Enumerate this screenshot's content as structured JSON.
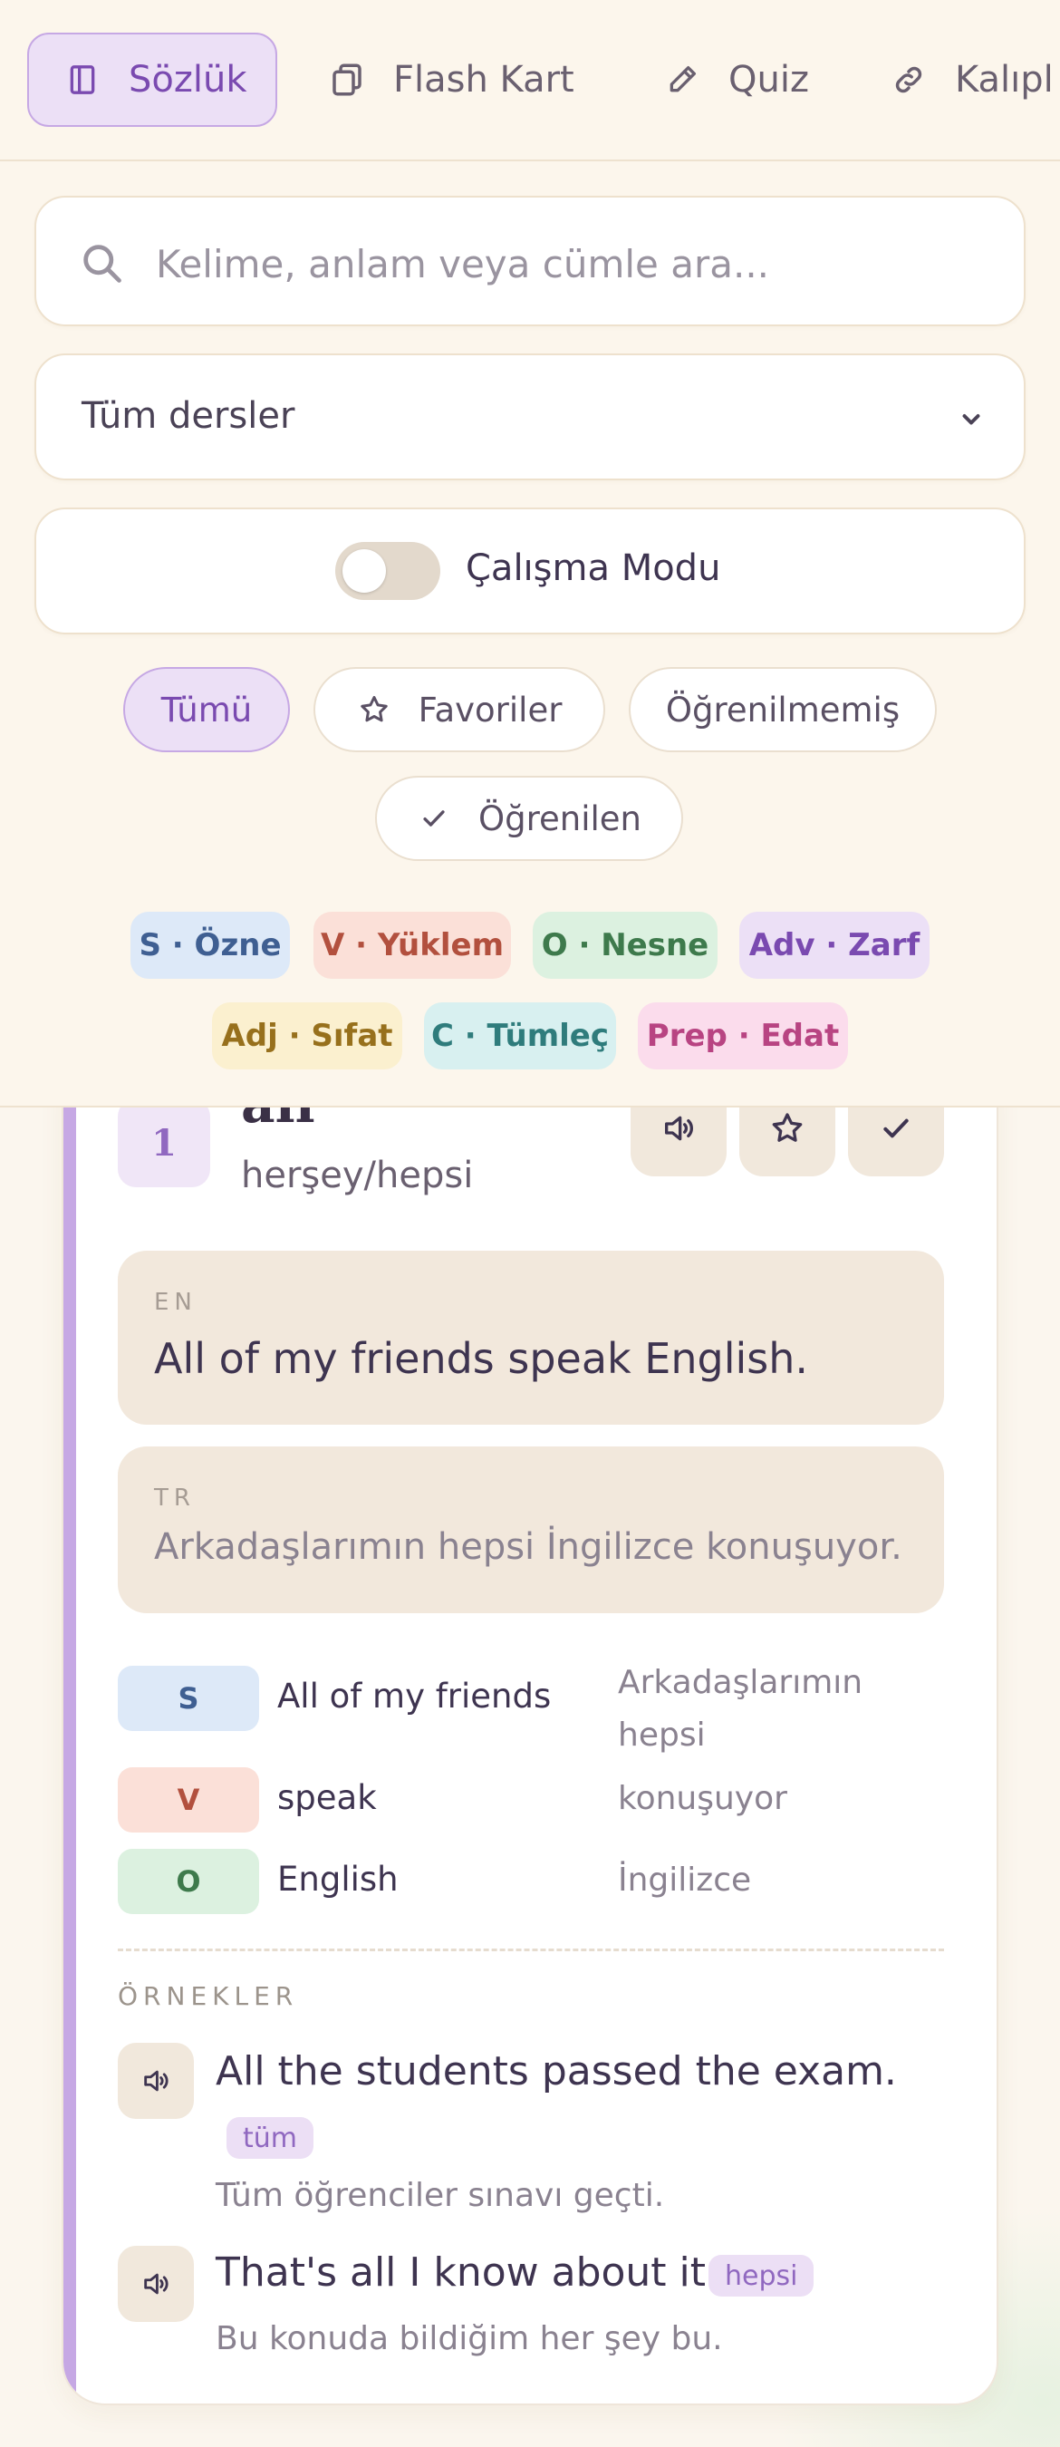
{
  "nav": {
    "items": [
      {
        "label": "Sözlük",
        "icon": "book-icon",
        "active": true
      },
      {
        "label": "Flash Kart",
        "icon": "cards-icon"
      },
      {
        "label": "Quiz",
        "icon": "pencil-icon"
      },
      {
        "label": "Kalıpl",
        "icon": "link-icon"
      }
    ]
  },
  "search": {
    "placeholder": "Kelime, anlam veya cümle ara...",
    "value": ""
  },
  "lesson_select": {
    "selected": "Tüm dersler"
  },
  "study_mode": {
    "label": "Çalışma Modu",
    "enabled": false
  },
  "filters": [
    {
      "label": "Tümü",
      "active": true
    },
    {
      "label": "Favoriler",
      "icon": "star-icon"
    },
    {
      "label": "Öğrenilmemiş"
    },
    {
      "label": "Öğrenilen",
      "icon": "check-icon"
    }
  ],
  "legend": [
    {
      "label": "S · Özne",
      "bg": "#dde9f8",
      "fg": "#3f5f92"
    },
    {
      "label": "V · Yüklem",
      "bg": "#fbe0d8",
      "fg": "#b2503e"
    },
    {
      "label": "O · Nesne",
      "bg": "#dcf1e0",
      "fg": "#3e7a4c"
    },
    {
      "label": "Adv · Zarf",
      "bg": "#ece0f6",
      "fg": "#7a4ab0"
    },
    {
      "label": "Adj · Sıfat",
      "bg": "#fbf0cf",
      "fg": "#97701c"
    },
    {
      "label": "C · Tümleç",
      "bg": "#d8f0f0",
      "fg": "#2f7c7c"
    },
    {
      "label": "Prep · Edat",
      "bg": "#fbdcec",
      "fg": "#b84482"
    }
  ],
  "card": {
    "number": "1",
    "word": "all",
    "meaning": "herşey/hepsi",
    "accent": "#c6a8e4",
    "en_label": "EN",
    "en_sentence": "All of my friends speak English.",
    "tr_label": "TR",
    "tr_sentence": "Arkadaşlarımın hepsi İngilizce konuşuyor.",
    "roles": [
      {
        "tag": "S",
        "en": "All of my friends",
        "tr": "Arkadaşlarımın hepsi",
        "bg": "#dde9f8",
        "fg": "#3f5f92"
      },
      {
        "tag": "V",
        "en": "speak",
        "tr": "konuşuyor",
        "bg": "#fbe0d8",
        "fg": "#b2503e"
      },
      {
        "tag": "O",
        "en": "English",
        "tr": "İngilizce",
        "bg": "#dcf1e0",
        "fg": "#3e7a4c"
      }
    ],
    "examples_title": "ÖRNEKLER",
    "examples": [
      {
        "en": "All the students passed the exam.",
        "tag": "tüm",
        "tr": "Tüm öğrenciler sınavı geçti."
      },
      {
        "en": "That's all I know about it.",
        "tag": "hepsi",
        "tr": "Bu konuda bildiğim her şey bu."
      }
    ]
  }
}
